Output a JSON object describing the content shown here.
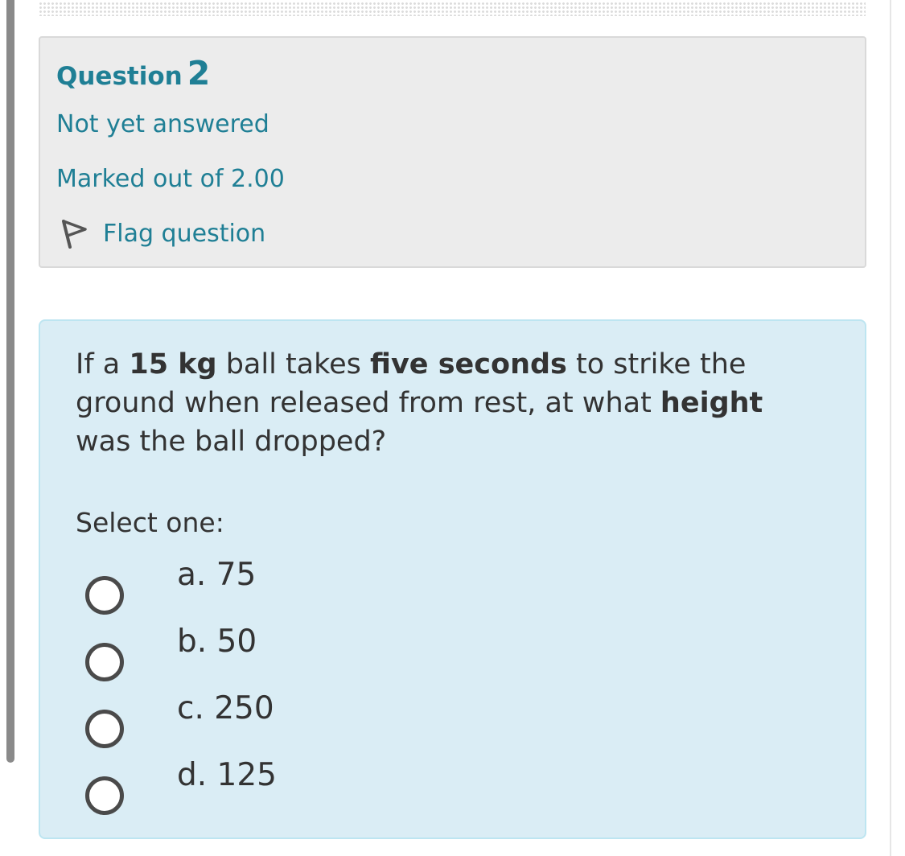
{
  "info": {
    "question_word": "Question",
    "question_number": "2",
    "state": "Not yet answered",
    "grade": "Marked out of 2.00",
    "flag_label": "Flag question"
  },
  "question": {
    "parts": [
      {
        "text": "If a ",
        "bold": false
      },
      {
        "text": "15 kg",
        "bold": true
      },
      {
        "text": " ball takes ",
        "bold": false
      },
      {
        "text": "five seconds",
        "bold": true
      },
      {
        "text": " to strike the ground when released from rest, at what ",
        "bold": false
      },
      {
        "text": "height",
        "bold": true
      },
      {
        "text": " was the ball dropped?",
        "bold": false
      }
    ],
    "prompt": "Select one:",
    "answers": [
      {
        "label": "a. 75",
        "selected": false
      },
      {
        "label": "b. 50",
        "selected": false
      },
      {
        "label": "c. 250",
        "selected": false
      },
      {
        "label": "d. 125",
        "selected": false
      }
    ]
  },
  "icons": {
    "flag": "flag-outline-icon",
    "radio": "radio-unchecked-icon"
  },
  "colors": {
    "info_text": "#1f7f95",
    "info_background": "#ececec",
    "content_background": "#daedf5",
    "content_border": "#bde5f1",
    "body_text": "#333333"
  }
}
